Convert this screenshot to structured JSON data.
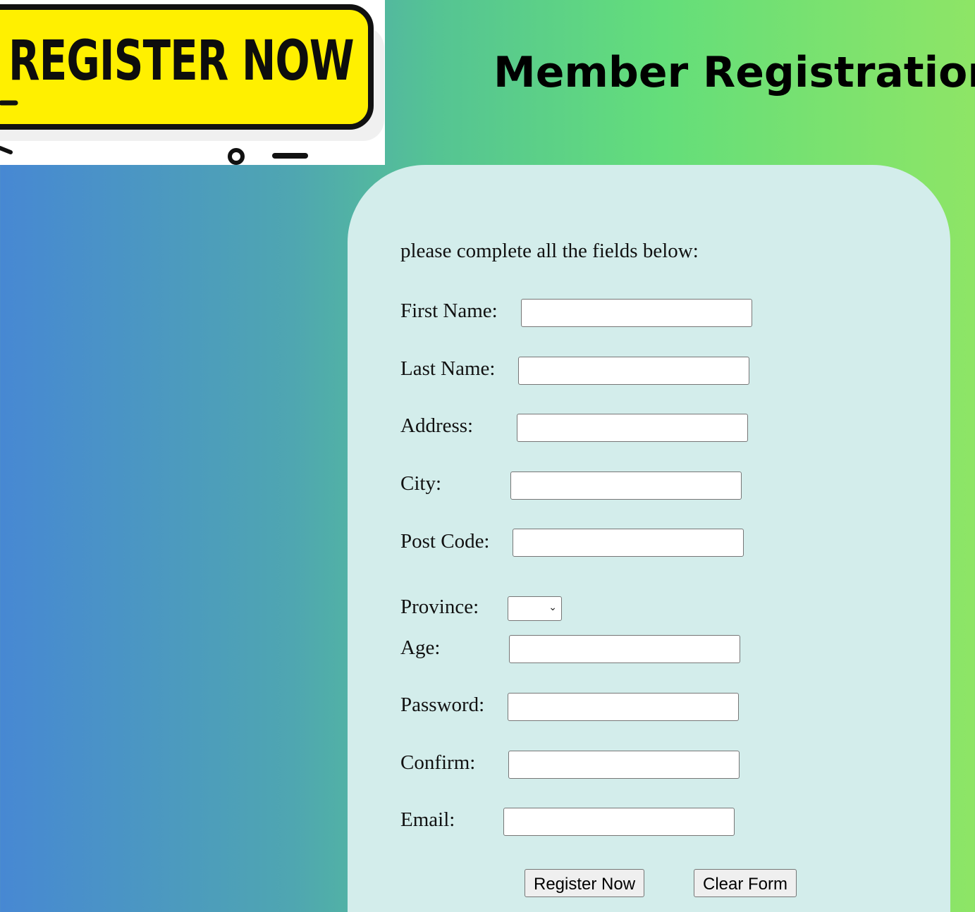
{
  "banner": {
    "text": "REGISTER NOW"
  },
  "header": {
    "title": "Member Registration"
  },
  "form": {
    "instructions": "please complete all the fields below:",
    "fields": {
      "first_name": {
        "label": "First Name:",
        "value": ""
      },
      "last_name": {
        "label": "Last Name:",
        "value": ""
      },
      "address": {
        "label": "Address:",
        "value": ""
      },
      "city": {
        "label": "City:",
        "value": ""
      },
      "post_code": {
        "label": "Post Code:",
        "value": ""
      },
      "province": {
        "label": "Province:",
        "selected": ""
      },
      "age": {
        "label": "Age:",
        "value": ""
      },
      "password": {
        "label": "Password:",
        "value": ""
      },
      "confirm": {
        "label": "Confirm:",
        "value": ""
      },
      "email": {
        "label": "Email:",
        "value": ""
      }
    },
    "buttons": {
      "register": "Register Now",
      "clear": "Clear Form"
    }
  },
  "icons": {
    "select_chevron": "chevron-down-icon"
  },
  "colors": {
    "banner_yellow": "#fff000",
    "card_background": "#d3edeb",
    "gradient_left": "#4788d3",
    "gradient_right": "#8ee566"
  }
}
